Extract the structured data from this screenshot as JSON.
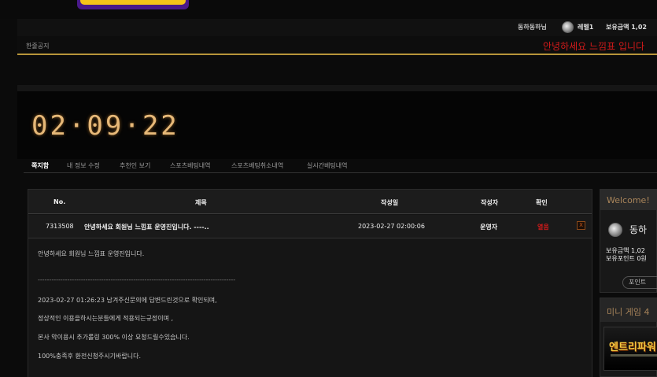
{
  "header": {
    "user_name": "동하동하님",
    "level": "레벨1",
    "money_label": "보유금액 1,02"
  },
  "notice": {
    "label": "한줄공지",
    "text": "안녕하세요 느낌표 입니다"
  },
  "clock": "02·09·22",
  "tabs": [
    {
      "label": "쪽지함",
      "active": true
    },
    {
      "label": "내 정보 수정"
    },
    {
      "label": "추천인 보기"
    },
    {
      "label": "스포츠베팅내역"
    },
    {
      "label": "스포츠베팅취소내역"
    },
    {
      "label": "실시간베팅내역"
    }
  ],
  "table": {
    "headers": {
      "no": "No.",
      "title": "제목",
      "date": "작성일",
      "author": "작성자",
      "status": "확인"
    },
    "row": {
      "no": "7313508",
      "title": "안녕하세요 회원님 느낌표 운영진입니다. ----..",
      "date": "2023-02-27 02:00:06",
      "author": "운영자",
      "status": "열음",
      "delete": "X"
    },
    "body_lines": [
      "안녕하세요 회원님 느낌표 운영진입니다.",
      "---------------------------------------------------------------------------------------",
      "2023-02-27 01:26:23 남겨주신문의에 답변드린것으로 확인되며,",
      "정상적인 이용을하시는분들에게 적용되는규정이며 ,",
      "본사 악이용시 추가롤링 300% 이상 요청드릴수있습니다.",
      "100%충족후 환전신청주시기바랍니다."
    ]
  },
  "sidebar": {
    "welcome": "Welcome!",
    "name": "동하",
    "money": "보유금액 1,02",
    "points": "보유포인트 0원",
    "point_button": "포인트",
    "mini_game_title": "미니 게임 4",
    "game_banner_text": "엔트리파워"
  }
}
